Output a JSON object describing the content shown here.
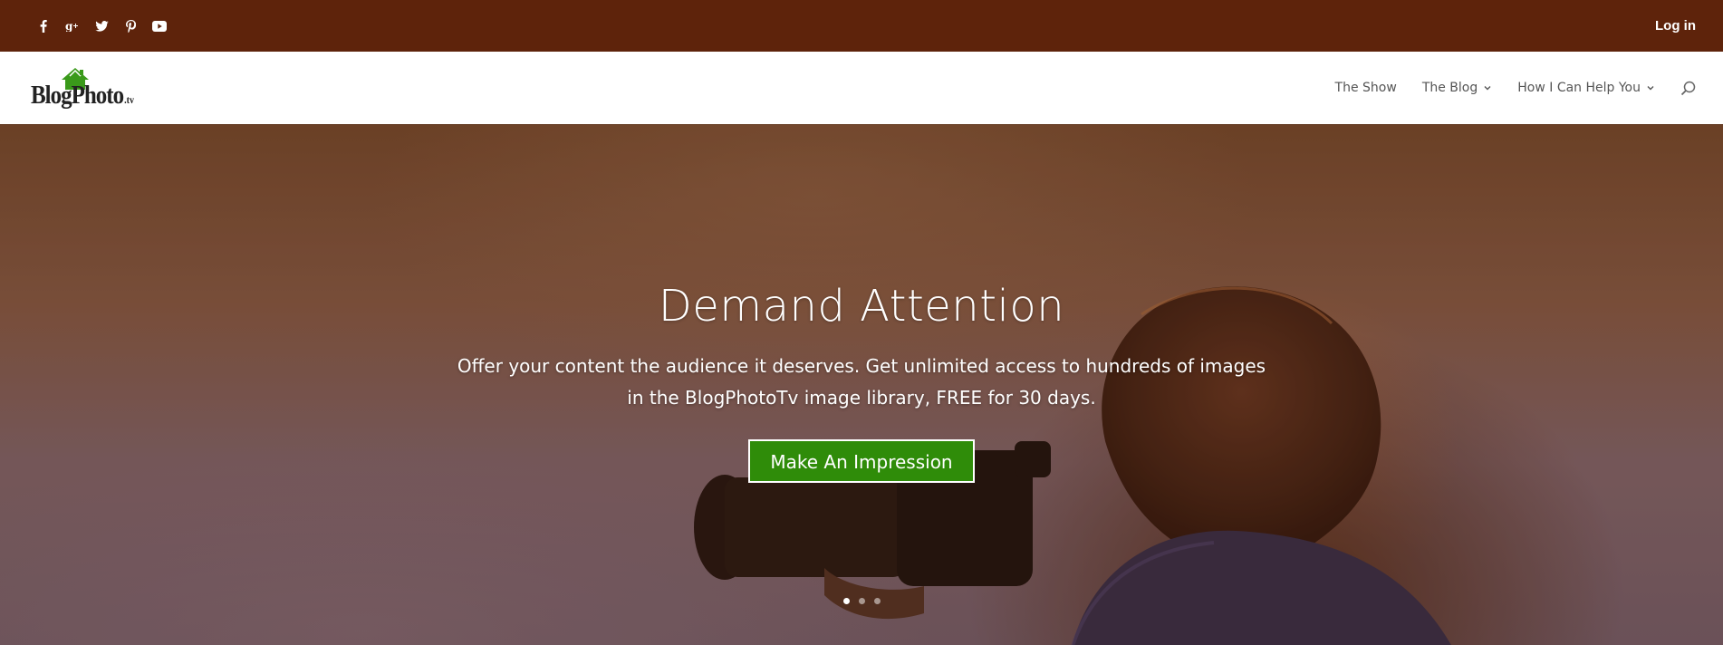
{
  "topbar": {
    "background": "#5e230b",
    "social_icons": [
      "facebook-icon",
      "google-plus-icon",
      "twitter-icon",
      "pinterest-icon",
      "youtube-icon"
    ],
    "login_label": "Log in"
  },
  "header": {
    "logo": {
      "text_blog": "Blog",
      "text_photo": "Photo",
      "text_tv": ".tv",
      "accent": "#3a9a1a"
    },
    "nav": [
      {
        "label": "The Show",
        "has_dropdown": false
      },
      {
        "label": "The Blog",
        "has_dropdown": true
      },
      {
        "label": "How I Can Help You",
        "has_dropdown": true
      }
    ],
    "search_icon": "search-icon"
  },
  "hero": {
    "title": "Demand Attention",
    "subtitle": "Offer your content the audience it deserves. Get unlimited access to hundreds of images in the BlogPhotoTv image library, FREE for 30 days.",
    "button_label": "Make An Impression",
    "button_color": "#2f8c09",
    "slides": 3,
    "active_slide": 1
  }
}
